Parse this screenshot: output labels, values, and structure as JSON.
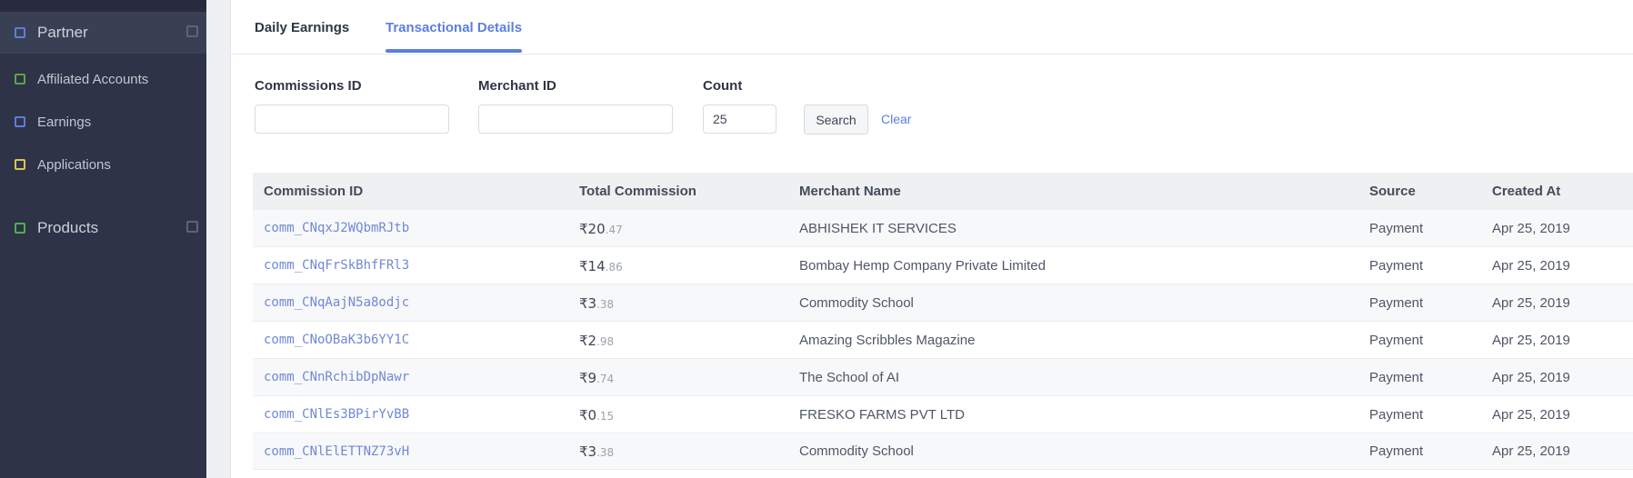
{
  "colors": {
    "sidebar_bg": "#2e3347",
    "sidebar_active_bg": "#3a4054",
    "accent_blue": "#5b7fdb",
    "link_blue": "#7089d6",
    "icon_blue": "#5b7fd8",
    "icon_green": "#5fa348",
    "icon_yellow": "#dfc157",
    "icon_green_bright": "#4db04f",
    "table_header_bg": "#eef0f2",
    "zebra_row_bg": "#f7f8f9"
  },
  "sidebar": {
    "items": [
      {
        "label": "Partner",
        "icon": "blue-square-icon",
        "type": "section",
        "active": true,
        "right_icon": "collapse-square-icon"
      },
      {
        "label": "Affiliated Accounts",
        "icon": "green-square-icon",
        "type": "sub"
      },
      {
        "label": "Earnings",
        "icon": "blue-square-icon",
        "type": "sub"
      },
      {
        "label": "Applications",
        "icon": "yellow-square-icon",
        "type": "sub"
      },
      {
        "label": "Products",
        "icon": "green-square-icon",
        "type": "section",
        "right_icon": "collapse-square-icon"
      }
    ]
  },
  "tabs": [
    {
      "label": "Daily Earnings",
      "active": false
    },
    {
      "label": "Transactional Details",
      "active": true
    }
  ],
  "filters": {
    "commissions_id_label": "Commissions ID",
    "commissions_id_value": "",
    "merchant_id_label": "Merchant ID",
    "merchant_id_value": "",
    "count_label": "Count",
    "count_value": "25",
    "search_label": "Search",
    "clear_label": "Clear"
  },
  "table": {
    "headers": [
      "Commission ID",
      "Total Commission",
      "Merchant Name",
      "Source",
      "Created At"
    ],
    "rows": [
      {
        "id": "comm_CNqxJ2WQbmRJtb",
        "amount_main": "₹20",
        "amount_frac": ".47",
        "merchant": "ABHISHEK IT SERVICES",
        "source": "Payment",
        "created_at": "Apr 25, 2019"
      },
      {
        "id": "comm_CNqFrSkBhfFRl3",
        "amount_main": "₹14",
        "amount_frac": ".86",
        "merchant": "Bombay Hemp Company Private Limited",
        "source": "Payment",
        "created_at": "Apr 25, 2019"
      },
      {
        "id": "comm_CNqAajN5a8odjc",
        "amount_main": "₹3",
        "amount_frac": ".38",
        "merchant": "Commodity School",
        "source": "Payment",
        "created_at": "Apr 25, 2019"
      },
      {
        "id": "comm_CNoOBaK3b6YY1C",
        "amount_main": "₹2",
        "amount_frac": ".98",
        "merchant": "Amazing Scribbles Magazine",
        "source": "Payment",
        "created_at": "Apr 25, 2019"
      },
      {
        "id": "comm_CNnRchibDpNawr",
        "amount_main": "₹9",
        "amount_frac": ".74",
        "merchant": "The School of AI",
        "source": "Payment",
        "created_at": "Apr 25, 2019"
      },
      {
        "id": "comm_CNlEs3BPirYvBB",
        "amount_main": "₹0",
        "amount_frac": ".15",
        "merchant": "FRESKO FARMS PVT LTD",
        "source": "Payment",
        "created_at": "Apr 25, 2019"
      },
      {
        "id": "comm_CNlElETTNZ73vH",
        "amount_main": "₹3",
        "amount_frac": ".38",
        "merchant": "Commodity School",
        "source": "Payment",
        "created_at": "Apr 25, 2019"
      }
    ]
  }
}
